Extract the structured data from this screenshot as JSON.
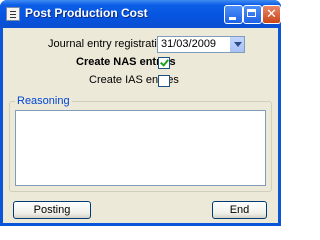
{
  "window": {
    "title": "Post Production Cost"
  },
  "form": {
    "journal_label": "Journal entry registration day",
    "journal_date": "31/03/2009",
    "nas_label": "Create NAS entries",
    "nas_checked": true,
    "ias_label": "Create IAS entries",
    "ias_checked": false,
    "reasoning_legend": "Reasoning",
    "reasoning_value": ""
  },
  "buttons": {
    "posting": "Posting",
    "end": "End"
  },
  "icons": {
    "app": "document-icon",
    "minimize": "minimize-icon",
    "maximize": "maximize-icon",
    "close": "close-icon",
    "dropdown": "chevron-down-icon",
    "check": "checkmark-icon"
  },
  "colors": {
    "titlebar": "#0654e0",
    "close_button": "#c94618",
    "group_legend": "#0046d5",
    "checkmark": "#21a121"
  }
}
